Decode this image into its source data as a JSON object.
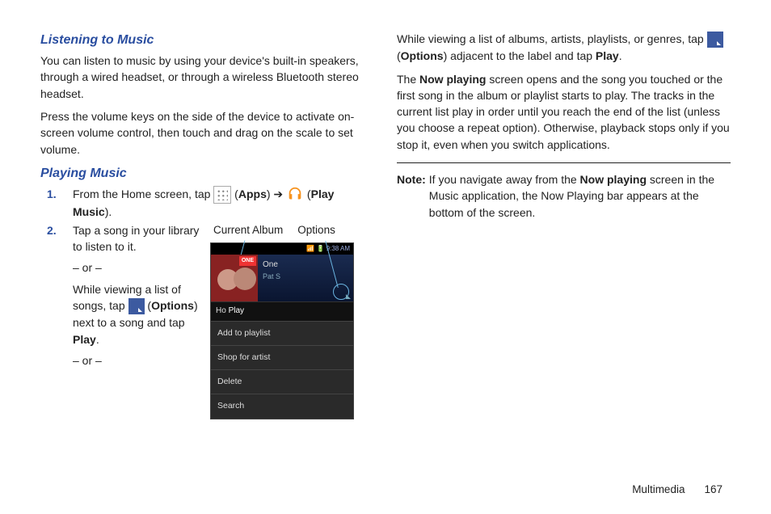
{
  "col1": {
    "heading1": "Listening to Music",
    "p1": "You can listen to music by using your device's built-in speakers, through a wired headset, or through a wireless Bluetooth stereo headset.",
    "p2": "Press the volume keys on the side of the device to activate on-screen volume control, then touch and drag on the scale to set volume.",
    "heading2": "Playing Music",
    "step1_a": "From the Home screen, tap ",
    "step1_apps": "Apps",
    "step1_arrow": "➔",
    "step1_play_music": "Play Music",
    "step2_a": "Tap a song in your library to listen to it.",
    "or": "– or –",
    "step2_b1": "While viewing a list of songs, tap ",
    "step2_b2_options": "Options",
    "step2_b3": ") next to a song and tap ",
    "step2_b4_play": "Play",
    "callout_current": "Current Album",
    "callout_options": "Options",
    "phone": {
      "time": "9:38 AM",
      "album_badge": "ONE",
      "track_title": "One",
      "track_artist": "Pat S",
      "menu_header": "Ho",
      "menu1": "Play",
      "menu2": "Add to playlist",
      "menu3": "Shop for artist",
      "menu4": "Delete",
      "menu5": "Search"
    }
  },
  "col2": {
    "p1_a": "While viewing a list of albums, artists, playlists, or genres, tap ",
    "p1_options": "Options",
    "p1_b": ") adjacent to the label and tap ",
    "p1_play": "Play",
    "p2_a": "The ",
    "p2_now_playing": "Now playing",
    "p2_b": " screen opens and the song you touched or the first song in the album or playlist starts to play. The tracks in the current list play in order until you reach the end of the list (unless you choose a repeat option). Otherwise, playback stops only if you stop it, even when you switch applications.",
    "note_label": "Note:",
    "note_a": "If you navigate away from the ",
    "note_now_playing": "Now playing",
    "note_b": " screen in the Music application, the Now Playing bar appears at the bottom of the screen."
  },
  "footer": {
    "section": "Multimedia",
    "page": "167"
  }
}
